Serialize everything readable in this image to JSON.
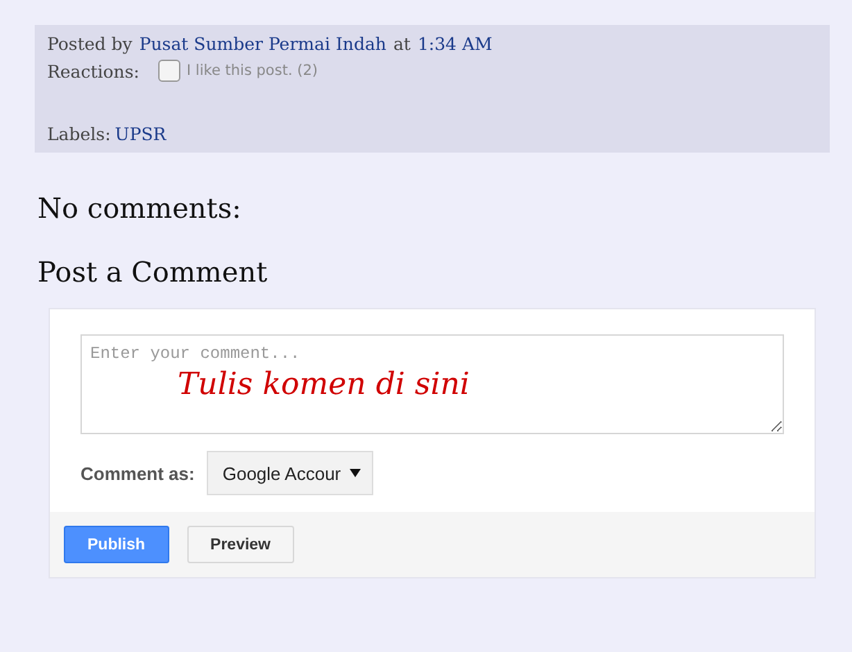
{
  "post_footer": {
    "posted_by_prefix": "Posted by",
    "author": "Pusat Sumber Permai Indah",
    "at": "at",
    "time": "1:34 AM",
    "reactions_label": "Reactions:",
    "reaction": {
      "label": "I like this post. (2)",
      "checked": false
    },
    "labels_prefix": "Labels:",
    "labels": [
      "UPSR"
    ]
  },
  "comments_heading": "No comments:",
  "post_comment_heading": "Post a Comment",
  "comment_form": {
    "placeholder": "Enter your comment...",
    "annotation": "Tulis komen di sini",
    "comment_as_label": "Comment as:",
    "identity": "Google Accour",
    "buttons": [
      {
        "label": "Publish",
        "kind": "primary"
      },
      {
        "label": "Preview",
        "kind": "secondary"
      }
    ]
  }
}
